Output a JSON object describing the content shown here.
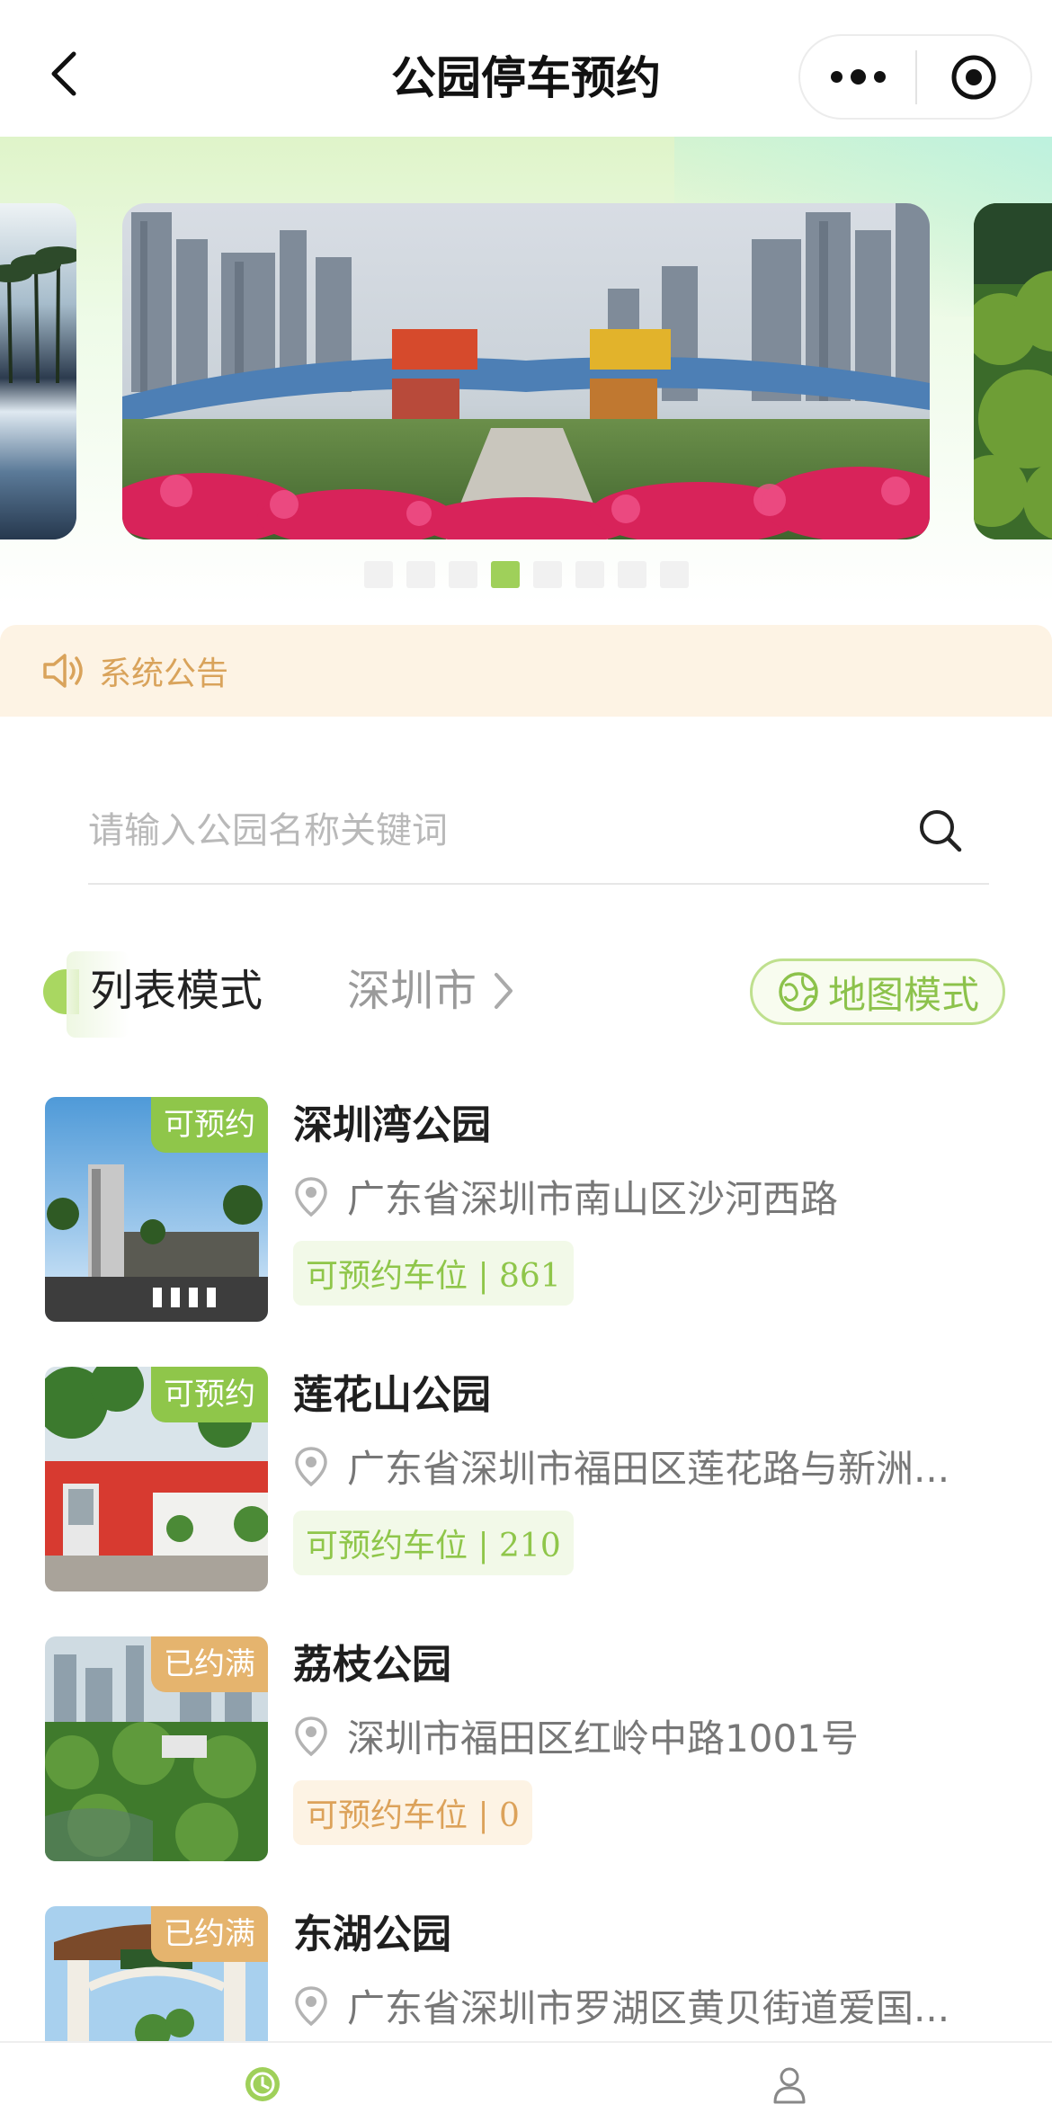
{
  "header": {
    "title": "公园停车预约"
  },
  "banner": {
    "dots_count": 8,
    "active_dot": 4
  },
  "notice": {
    "label": "系统公告"
  },
  "search": {
    "placeholder": "请输入公园名称关键词"
  },
  "mode": {
    "list_label": "列表模式",
    "city_label": "深圳市",
    "map_label": "地图模式"
  },
  "parks": [
    {
      "name": "深圳湾公园",
      "badge": "可预约",
      "status": "available",
      "address": "广东省深圳市南山区沙河西路",
      "slots_label": "可预约车位 | 861"
    },
    {
      "name": "莲花山公园",
      "badge": "可预约",
      "status": "available",
      "address": "广东省深圳市福田区莲花路与新洲...",
      "slots_label": "可预约车位 | 210"
    },
    {
      "name": "荔枝公园",
      "badge": "已约满",
      "status": "full",
      "address": "深圳市福田区红岭中路1001号",
      "slots_label": "可预约车位 | 0"
    },
    {
      "name": "东湖公园",
      "badge": "已约满",
      "status": "full",
      "address": "广东省深圳市罗湖区黄贝街道爱国...",
      "slots_label": ""
    }
  ],
  "colors": {
    "accent_green": "#8fc64a",
    "accent_orange": "#dca25a",
    "notice_bg": "#fdf3e4"
  },
  "tabbar": {
    "tabs": [
      "home-clock-icon",
      "profile-icon"
    ]
  }
}
